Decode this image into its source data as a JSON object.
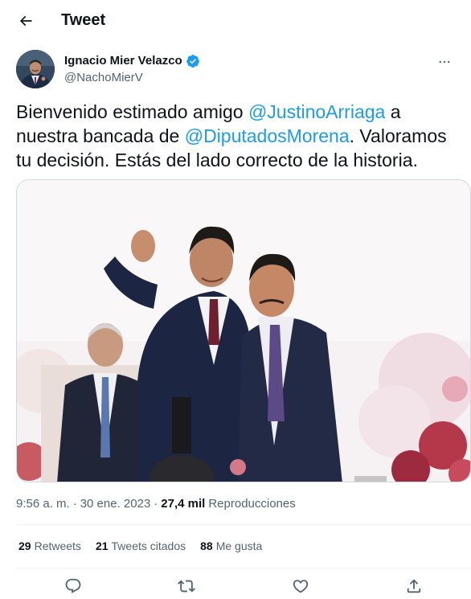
{
  "header": {
    "title": "Tweet",
    "back_icon": "arrow-left-icon"
  },
  "author": {
    "name": "Ignacio Mier Velazco",
    "handle": "@NachoMierV",
    "verified_icon": "verified-badge-icon",
    "verified_color": "#1d9bf0"
  },
  "tweet": {
    "text_1": "Bienvenido estimado amigo ",
    "mention_1": "@JustinoArriaga",
    "text_2": " a nuestra bancada de ",
    "mention_2": "@DiputadosMorena",
    "text_3": ". Valoramos tu decisión. Estás del lado correcto de la historia."
  },
  "meta": {
    "time": "9:56 a. m.",
    "separator_1": "·",
    "date": "30 ene. 2023",
    "separator_2": "·",
    "views": "27,4 mil",
    "views_label": "Reproducciones"
  },
  "stats": {
    "retweets_count": "29",
    "retweets_label": "Retweets",
    "quotes_count": "21",
    "quotes_label": "Tweets citados",
    "likes_count": "88",
    "likes_label": "Me gusta"
  },
  "actions": {
    "reply_icon": "reply-icon",
    "retweet_icon": "retweet-icon",
    "like_icon": "heart-icon",
    "share_icon": "share-icon"
  },
  "colors": {
    "text": "#0f1419",
    "secondary": "#536471",
    "accent": "#1d9bf0",
    "border": "#eff3f4"
  }
}
